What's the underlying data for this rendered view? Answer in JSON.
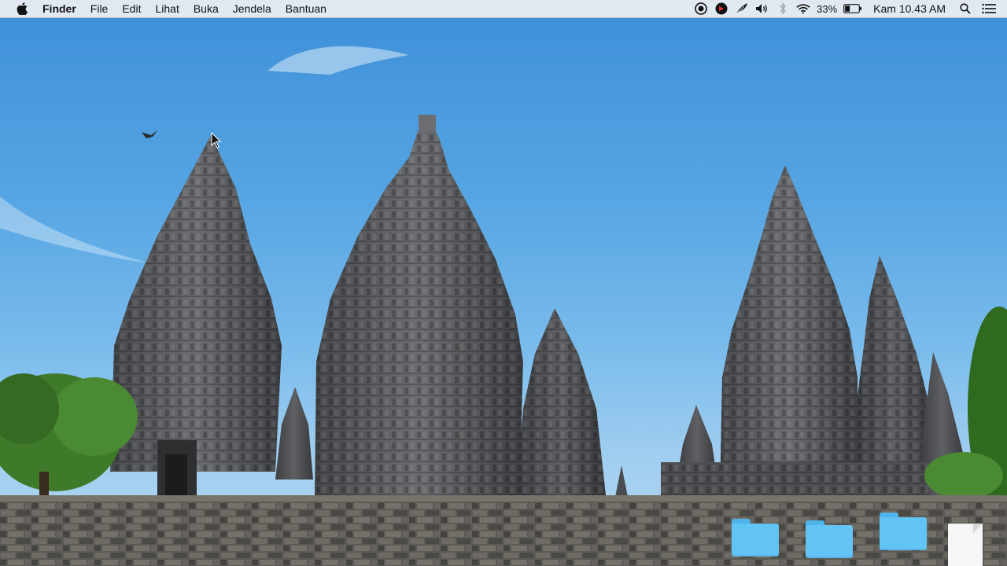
{
  "menubar": {
    "app_name": "Finder",
    "menus": [
      "File",
      "Edit",
      "Lihat",
      "Buka",
      "Jendela",
      "Bantuan"
    ],
    "status": {
      "battery_percent": "33%",
      "clock": "Kam 10.43 AM"
    },
    "status_icons": [
      "screen-record-icon",
      "app-status-icon",
      "feather-icon",
      "volume-icon",
      "bluetooth-icon",
      "wifi-icon",
      "battery-icon",
      "spotlight-search-icon",
      "notification-center-icon"
    ]
  },
  "desktop": {
    "items": [
      {
        "type": "folder",
        "label": ""
      },
      {
        "type": "folder",
        "label": ""
      },
      {
        "type": "folder",
        "label": ""
      },
      {
        "type": "document",
        "label": ""
      }
    ]
  },
  "colors": {
    "sky_top": "#3d8fd8",
    "sky_bottom": "#b9d9f1",
    "stone": "#55575a",
    "folder": "#62c3f5",
    "foliage": "#3f7a2b"
  }
}
